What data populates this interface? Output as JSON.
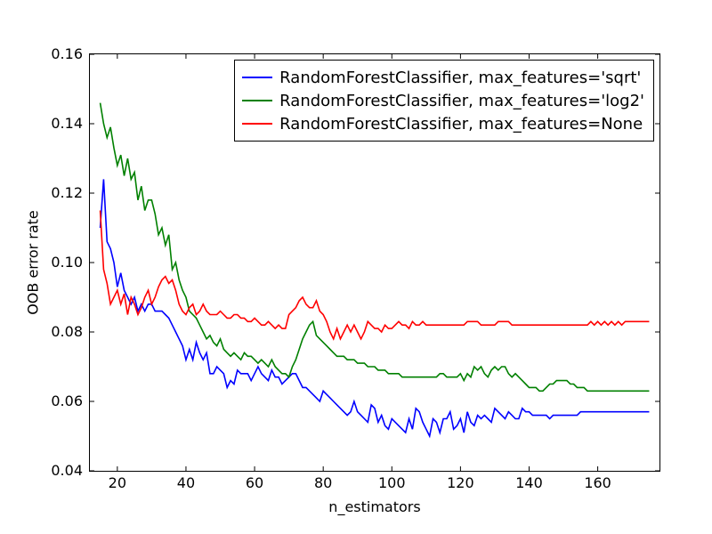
{
  "chart_data": {
    "type": "line",
    "xlabel": "n_estimators",
    "ylabel": "OOB error rate",
    "xlim": [
      12,
      178
    ],
    "ylim": [
      0.04,
      0.16
    ],
    "x_ticks": [
      20,
      40,
      60,
      80,
      100,
      120,
      140,
      160
    ],
    "y_ticks": [
      0.04,
      0.06,
      0.08,
      0.1,
      0.12,
      0.14,
      0.16
    ],
    "x": [
      15,
      16,
      17,
      18,
      19,
      20,
      21,
      22,
      23,
      24,
      25,
      26,
      27,
      28,
      29,
      30,
      31,
      32,
      33,
      34,
      35,
      36,
      37,
      38,
      39,
      40,
      41,
      42,
      43,
      44,
      45,
      46,
      47,
      48,
      49,
      50,
      51,
      52,
      53,
      54,
      55,
      56,
      57,
      58,
      59,
      60,
      61,
      62,
      63,
      64,
      65,
      66,
      67,
      68,
      69,
      70,
      71,
      72,
      73,
      74,
      75,
      76,
      77,
      78,
      79,
      80,
      81,
      82,
      83,
      84,
      85,
      86,
      87,
      88,
      89,
      90,
      91,
      92,
      93,
      94,
      95,
      96,
      97,
      98,
      99,
      100,
      101,
      102,
      103,
      104,
      105,
      106,
      107,
      108,
      109,
      110,
      111,
      112,
      113,
      114,
      115,
      116,
      117,
      118,
      119,
      120,
      121,
      122,
      123,
      124,
      125,
      126,
      127,
      128,
      129,
      130,
      131,
      132,
      133,
      134,
      135,
      136,
      137,
      138,
      139,
      140,
      141,
      142,
      143,
      144,
      145,
      146,
      147,
      148,
      149,
      150,
      151,
      152,
      153,
      154,
      155,
      156,
      157,
      158,
      159,
      160,
      161,
      162,
      163,
      164,
      165,
      166,
      167,
      168,
      169,
      170,
      171,
      172,
      173,
      174,
      175
    ],
    "series": [
      {
        "name": "RandomForestClassifier, max_features='sqrt'",
        "color": "#0000ff",
        "values": [
          0.11,
          0.124,
          0.106,
          0.104,
          0.1,
          0.093,
          0.097,
          0.092,
          0.09,
          0.088,
          0.09,
          0.086,
          0.088,
          0.086,
          0.088,
          0.088,
          0.086,
          0.086,
          0.086,
          0.085,
          0.084,
          0.082,
          0.08,
          0.078,
          0.076,
          0.072,
          0.075,
          0.072,
          0.077,
          0.074,
          0.072,
          0.074,
          0.068,
          0.068,
          0.07,
          0.069,
          0.068,
          0.064,
          0.066,
          0.065,
          0.069,
          0.068,
          0.068,
          0.068,
          0.066,
          0.068,
          0.07,
          0.068,
          0.067,
          0.066,
          0.069,
          0.067,
          0.067,
          0.065,
          0.066,
          0.067,
          0.068,
          0.068,
          0.066,
          0.064,
          0.064,
          0.063,
          0.062,
          0.061,
          0.06,
          0.063,
          0.062,
          0.061,
          0.06,
          0.059,
          0.058,
          0.057,
          0.056,
          0.057,
          0.06,
          0.057,
          0.056,
          0.055,
          0.054,
          0.059,
          0.058,
          0.054,
          0.056,
          0.053,
          0.052,
          0.055,
          0.054,
          0.053,
          0.052,
          0.051,
          0.055,
          0.052,
          0.058,
          0.057,
          0.054,
          0.052,
          0.05,
          0.055,
          0.054,
          0.051,
          0.055,
          0.055,
          0.057,
          0.052,
          0.053,
          0.055,
          0.051,
          0.057,
          0.054,
          0.053,
          0.056,
          0.055,
          0.056,
          0.055,
          0.054,
          0.058,
          0.057,
          0.056,
          0.055,
          0.057,
          0.056,
          0.055,
          0.055,
          0.058,
          0.057,
          0.057,
          0.056,
          0.056,
          0.056,
          0.056,
          0.056,
          0.055,
          0.056,
          0.056,
          0.056,
          0.056,
          0.056,
          0.056,
          0.056,
          0.056,
          0.057,
          0.057,
          0.057,
          0.057,
          0.057,
          0.057,
          0.057,
          0.057,
          0.057,
          0.057,
          0.057,
          0.057,
          0.057,
          0.057,
          0.057,
          0.057,
          0.057,
          0.057,
          0.057,
          0.057,
          0.057
        ]
      },
      {
        "name": "RandomForestClassifier, max_features='log2'",
        "color": "#008000",
        "values": [
          0.146,
          0.14,
          0.136,
          0.139,
          0.133,
          0.128,
          0.131,
          0.125,
          0.13,
          0.124,
          0.126,
          0.118,
          0.122,
          0.115,
          0.118,
          0.118,
          0.114,
          0.108,
          0.11,
          0.105,
          0.108,
          0.098,
          0.1,
          0.095,
          0.092,
          0.09,
          0.086,
          0.085,
          0.084,
          0.082,
          0.08,
          0.078,
          0.079,
          0.077,
          0.076,
          0.078,
          0.075,
          0.074,
          0.073,
          0.074,
          0.073,
          0.072,
          0.074,
          0.073,
          0.073,
          0.072,
          0.071,
          0.072,
          0.071,
          0.07,
          0.072,
          0.07,
          0.069,
          0.068,
          0.068,
          0.067,
          0.07,
          0.072,
          0.075,
          0.078,
          0.08,
          0.082,
          0.083,
          0.079,
          0.078,
          0.077,
          0.076,
          0.075,
          0.074,
          0.073,
          0.073,
          0.073,
          0.072,
          0.072,
          0.072,
          0.071,
          0.071,
          0.071,
          0.07,
          0.07,
          0.07,
          0.069,
          0.069,
          0.069,
          0.068,
          0.068,
          0.068,
          0.068,
          0.067,
          0.067,
          0.067,
          0.067,
          0.067,
          0.067,
          0.067,
          0.067,
          0.067,
          0.067,
          0.067,
          0.068,
          0.068,
          0.067,
          0.067,
          0.067,
          0.067,
          0.068,
          0.066,
          0.068,
          0.067,
          0.07,
          0.069,
          0.07,
          0.068,
          0.067,
          0.069,
          0.07,
          0.069,
          0.07,
          0.07,
          0.068,
          0.067,
          0.068,
          0.067,
          0.066,
          0.065,
          0.064,
          0.064,
          0.064,
          0.063,
          0.063,
          0.064,
          0.065,
          0.065,
          0.066,
          0.066,
          0.066,
          0.066,
          0.065,
          0.065,
          0.064,
          0.064,
          0.064,
          0.063,
          0.063,
          0.063,
          0.063,
          0.063,
          0.063,
          0.063,
          0.063,
          0.063,
          0.063,
          0.063,
          0.063,
          0.063,
          0.063,
          0.063,
          0.063,
          0.063,
          0.063,
          0.063
        ]
      },
      {
        "name": "RandomForestClassifier, max_features=None",
        "color": "#ff0000",
        "values": [
          0.115,
          0.098,
          0.094,
          0.088,
          0.09,
          0.092,
          0.088,
          0.091,
          0.085,
          0.09,
          0.088,
          0.085,
          0.087,
          0.09,
          0.092,
          0.088,
          0.09,
          0.093,
          0.095,
          0.096,
          0.094,
          0.095,
          0.092,
          0.088,
          0.086,
          0.085,
          0.087,
          0.088,
          0.085,
          0.086,
          0.088,
          0.086,
          0.085,
          0.085,
          0.085,
          0.086,
          0.085,
          0.084,
          0.084,
          0.085,
          0.085,
          0.084,
          0.084,
          0.083,
          0.083,
          0.084,
          0.083,
          0.082,
          0.082,
          0.083,
          0.082,
          0.081,
          0.082,
          0.081,
          0.081,
          0.085,
          0.086,
          0.087,
          0.089,
          0.09,
          0.088,
          0.087,
          0.087,
          0.089,
          0.086,
          0.085,
          0.083,
          0.08,
          0.078,
          0.081,
          0.078,
          0.08,
          0.082,
          0.08,
          0.082,
          0.08,
          0.078,
          0.08,
          0.083,
          0.082,
          0.081,
          0.081,
          0.08,
          0.082,
          0.081,
          0.081,
          0.082,
          0.083,
          0.082,
          0.082,
          0.081,
          0.083,
          0.082,
          0.082,
          0.083,
          0.082,
          0.082,
          0.082,
          0.082,
          0.082,
          0.082,
          0.082,
          0.082,
          0.082,
          0.082,
          0.082,
          0.082,
          0.083,
          0.083,
          0.083,
          0.083,
          0.082,
          0.082,
          0.082,
          0.082,
          0.082,
          0.083,
          0.083,
          0.083,
          0.083,
          0.082,
          0.082,
          0.082,
          0.082,
          0.082,
          0.082,
          0.082,
          0.082,
          0.082,
          0.082,
          0.082,
          0.082,
          0.082,
          0.082,
          0.082,
          0.082,
          0.082,
          0.082,
          0.082,
          0.082,
          0.082,
          0.082,
          0.082,
          0.083,
          0.082,
          0.083,
          0.082,
          0.083,
          0.082,
          0.083,
          0.082,
          0.083,
          0.082,
          0.083,
          0.083,
          0.083,
          0.083,
          0.083,
          0.083,
          0.083,
          0.083
        ]
      }
    ]
  }
}
